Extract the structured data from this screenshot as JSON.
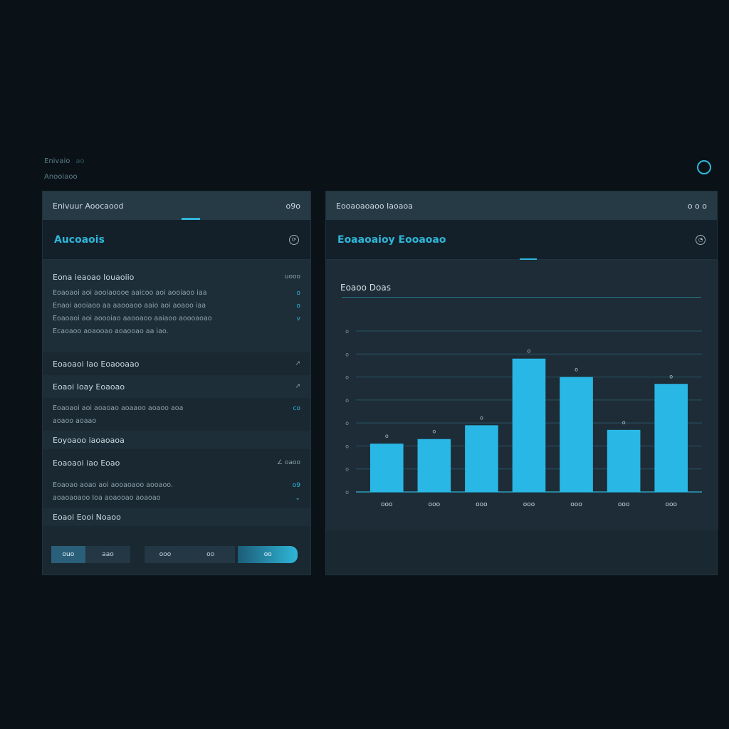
{
  "top_left": {
    "line1": "Enivaio",
    "line1_dim": "ao",
    "line2": "Anooiaoo"
  },
  "left_panel": {
    "header_title": "Enivuur Aoocaood",
    "header_value": "o9o",
    "title": "Aucoaois",
    "section1": {
      "title": "Eona ieaoao Iouaoiio",
      "value": "uooo",
      "lines": [
        "Eoaoaoi aoi aooiaoooe aaicoo aoi aooiaoo iaa",
        "Enaoi aooiaoo aa aaooaoo aaio aoi aoaoo iaa",
        "Eoaoaoi aoi aoooiao aaooaoo aaiaoo aoooaoao",
        "Ecaoaoo aoaooao aoaooao aa iao."
      ],
      "marks": [
        "o",
        "o",
        "v",
        ""
      ]
    },
    "row1": {
      "label": "Eoaoaoi Iao Eoaooaao",
      "value": "↗"
    },
    "row2": {
      "label": "Eoaoi Ioay Eoaoao",
      "value": "↗"
    },
    "section2": {
      "lines": [
        "Eoaoaoi aoi aoaoao aoaaoo aoaoo aoa",
        "aoaoo aoaao"
      ],
      "marks": [
        "co",
        ""
      ]
    },
    "row3": {
      "label": "Eoyoaoo iaoaoaoa"
    },
    "row4": {
      "label": "Eoaoaoi iao Eoao",
      "value": "∠ oaoo"
    },
    "section3": {
      "lines": [
        "Eoaoao aoao aoi aooaoaoo aooaoo.",
        "aoaoaoaoo Ioa aoaooao aoaoao"
      ],
      "marks": [
        "o9",
        "⌄"
      ]
    },
    "row5": {
      "label": "Eoaoi Eooi Noaoo"
    },
    "buttons": [
      "ouo",
      "aao",
      "ooo",
      "oo",
      "oo"
    ]
  },
  "right_panel": {
    "header_title": "Eooaoaoaoo Iaoaoa",
    "header_value": "o o o",
    "title": "Eoaaoaioy Eooaoao",
    "chart_label": "Eoaoo Doas"
  },
  "chart_data": {
    "type": "bar",
    "title": "Eoaoo Doas",
    "categories": [
      "ooo",
      "ooo",
      "ooo",
      "ooo",
      "ooo",
      "ooo",
      "ooo"
    ],
    "values": [
      21,
      23,
      29,
      58,
      50,
      27,
      47
    ],
    "data_labels": [
      "o",
      "o",
      "o",
      "o",
      "o",
      "o",
      "o"
    ],
    "yticks": [
      "o",
      "o",
      "o",
      "o",
      "o",
      "o",
      "o",
      "o"
    ],
    "ylim": [
      0,
      70
    ],
    "grid": true,
    "bar_color": "#29b8e6"
  },
  "colors": {
    "accent": "#2fb6d8",
    "panel": "#1a2832",
    "header": "#263a46",
    "background": "#0a1218"
  }
}
